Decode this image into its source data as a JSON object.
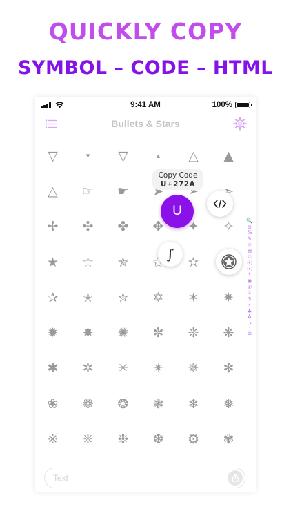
{
  "promo": {
    "headline": "QUICKLY COPY",
    "subheadline": "SYMBOL – CODE – HTML"
  },
  "status_bar": {
    "time": "9:41 AM",
    "battery": "100%"
  },
  "navbar": {
    "title": "Bullets & Stars"
  },
  "colors": {
    "accent": "#8a12e8",
    "headline": "#c04dec",
    "subheadline": "#8413e8",
    "index": "#c176f0",
    "glyph": "#9a9a9a"
  },
  "symbols": [
    "▽",
    "▾",
    "▽",
    "▴",
    "△",
    "▲",
    "△",
    "☞",
    "☛",
    "➤",
    "➢",
    "➣",
    "✢",
    "✣",
    "✤",
    "✥",
    "✦",
    "✧",
    "★",
    "☆",
    "✯",
    "✩",
    "✫",
    "✪",
    "✰",
    "✭",
    "✮",
    "✡",
    "✶",
    "✷",
    "✹",
    "✸",
    "✺",
    "✼",
    "❊",
    "❋",
    "✱",
    "✲",
    "✳",
    "✴",
    "✵",
    "✻",
    "❀",
    "❁",
    "❂",
    "❃",
    "❄",
    "❅",
    "※",
    "❈",
    "❉",
    "❆",
    "⚙",
    "✾"
  ],
  "tooltip": {
    "title": "Copy Code",
    "code": "U+272A"
  },
  "actions": {
    "copy_symbol_label": "U",
    "symbol_label": "∫"
  },
  "section_index": [
    "🔍",
    "⊕",
    "%",
    "✎",
    "☼",
    "⌘",
    "♲",
    "⦿",
    "⦿",
    "↑",
    "◉",
    "✆",
    "↕",
    "$",
    "⚡",
    "♣",
    "A",
    "→",
    "⋮",
    "☰"
  ],
  "input": {
    "placeholder": "Text"
  }
}
